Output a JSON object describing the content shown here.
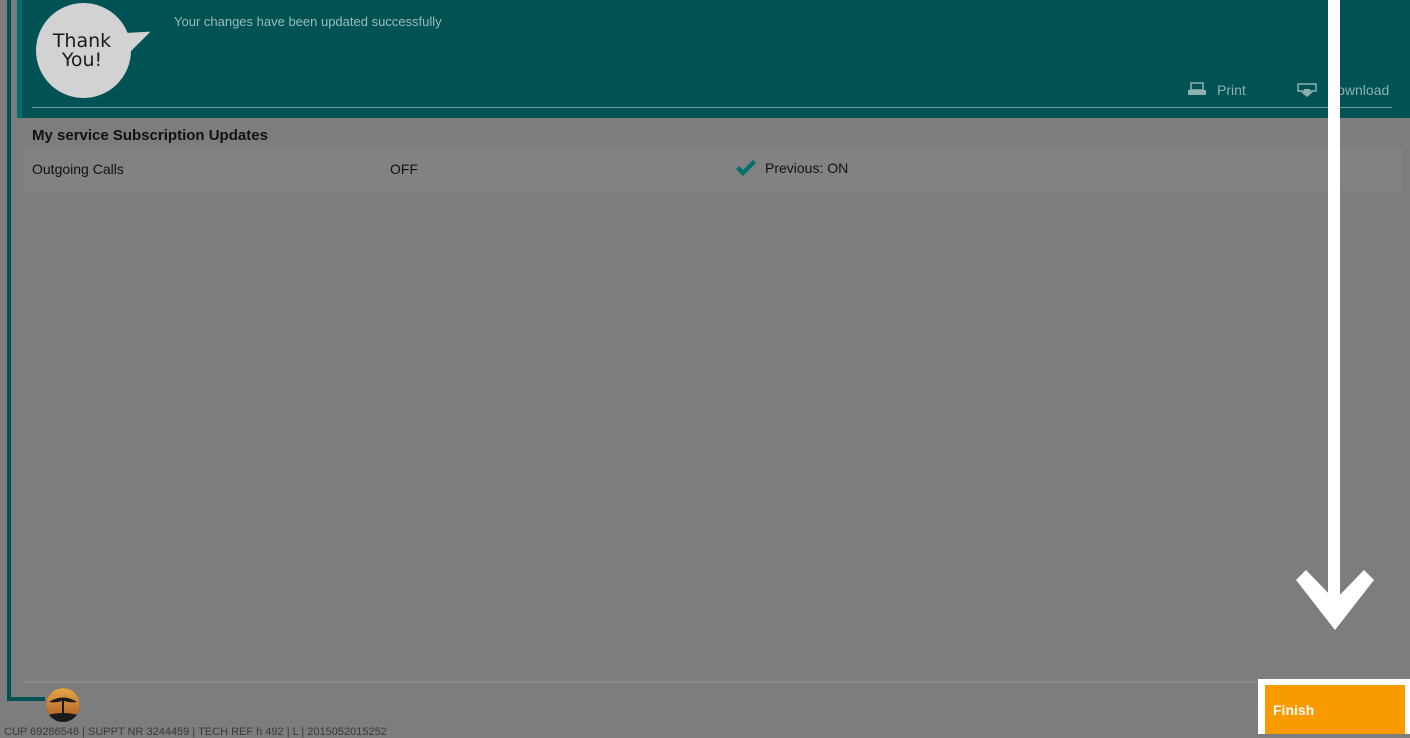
{
  "header": {
    "bubble_text": "Thank\nYou!",
    "success_message": "Your changes have been updated successfully",
    "print_label": "Print",
    "download_label": "Download"
  },
  "section": {
    "title": "My service Subscription Updates",
    "rows": [
      {
        "service": "Outgoing Calls",
        "value": "OFF",
        "previous": "Previous: ON"
      }
    ]
  },
  "footer": {
    "ref_text": "CUP 69286546 | SUPPT NR 3244459 | TECH REF h 492 | L | 2015052015252"
  },
  "actions": {
    "finish_label": "Finish"
  },
  "colors": {
    "header_bg": "#005254",
    "accent_check": "#00706f",
    "finish_button": "#f99b00",
    "overlay": "#7d7d7d"
  },
  "icons": [
    "print-icon",
    "download-icon",
    "checkmark-icon",
    "bank-logo",
    "down-arrow-icon"
  ]
}
